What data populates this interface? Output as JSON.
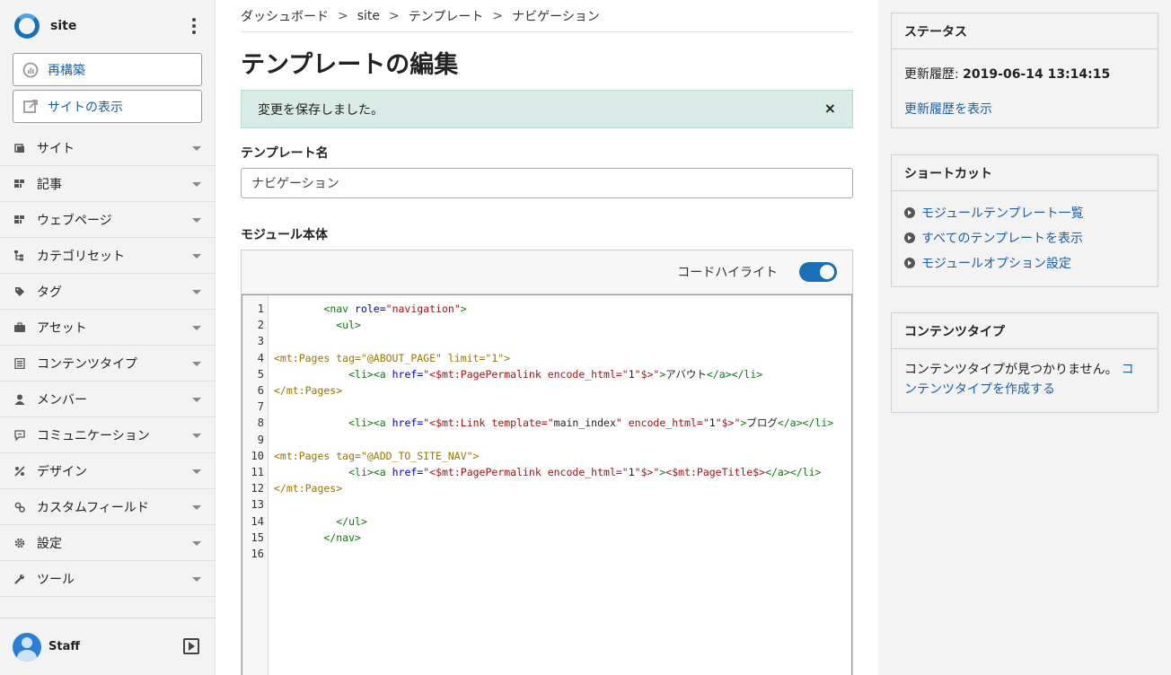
{
  "sidebar": {
    "site_name": "site",
    "rebuild_label": "再構築",
    "view_site_label": "サイトの表示",
    "items": [
      {
        "label": "サイト",
        "icon": "site-icon"
      },
      {
        "label": "記事",
        "icon": "entry-icon"
      },
      {
        "label": "ウェブページ",
        "icon": "page-icon"
      },
      {
        "label": "カテゴリセット",
        "icon": "category-set-icon"
      },
      {
        "label": "タグ",
        "icon": "tag-icon"
      },
      {
        "label": "アセット",
        "icon": "asset-icon"
      },
      {
        "label": "コンテンツタイプ",
        "icon": "content-type-icon"
      },
      {
        "label": "メンバー",
        "icon": "member-icon"
      },
      {
        "label": "コミュニケーション",
        "icon": "communication-icon"
      },
      {
        "label": "デザイン",
        "icon": "design-icon"
      },
      {
        "label": "カスタムフィールド",
        "icon": "custom-field-icon"
      },
      {
        "label": "設定",
        "icon": "gear-icon"
      },
      {
        "label": "ツール",
        "icon": "wrench-icon"
      }
    ],
    "user_name": "Staff"
  },
  "breadcrumb": [
    "ダッシュボード",
    "site",
    "テンプレート",
    "ナビゲーション"
  ],
  "breadcrumb_sep": ">",
  "page_title": "テンプレートの編集",
  "alert": {
    "message": "変更を保存しました。",
    "close": "×"
  },
  "template_name": {
    "label": "テンプレート名",
    "value": "ナビゲーション"
  },
  "module_body": {
    "label": "モジュール本体",
    "highlight_label": "コードハイライト",
    "highlight_on": true,
    "lines": [
      "        <nav role=\"navigation\">",
      "          <ul>",
      "",
      "<mt:Pages tag=\"@ABOUT_PAGE\" limit=\"1\">",
      "            <li><a href=\"<$mt:PagePermalink encode_html=\"1\"$>\">アバウト</a></li>",
      "</mt:Pages>",
      "",
      "            <li><a href=\"<$mt:Link template=\"main_index\" encode_html=\"1\"$>\">ブログ</a></li>",
      "",
      "<mt:Pages tag=\"@ADD_TO_SITE_NAV\">",
      "            <li><a href=\"<$mt:PagePermalink encode_html=\"1\"$>\"><$mt:PageTitle$></a></li>",
      "</mt:Pages>",
      "",
      "          </ul>",
      "        </nav>",
      ""
    ]
  },
  "status": {
    "title": "ステータス",
    "updated_label": "更新履歴:",
    "updated_value": "2019-06-14 13:14:15",
    "history_link": "更新履歴を表示"
  },
  "shortcuts": {
    "title": "ショートカット",
    "items": [
      "モジュールテンプレート一覧",
      "すべてのテンプレートを表示",
      "モジュールオプション設定"
    ]
  },
  "content_type": {
    "title": "コンテンツタイプ",
    "message": "コンテンツタイプが見つかりません。",
    "create_link": "コンテンツタイプを作成する"
  },
  "colors": {
    "accent": "#1a6fb6",
    "link": "#1a5fa8",
    "alert_bg": "#d9ebe7",
    "sidebar_bg": "#f3f3f3"
  }
}
